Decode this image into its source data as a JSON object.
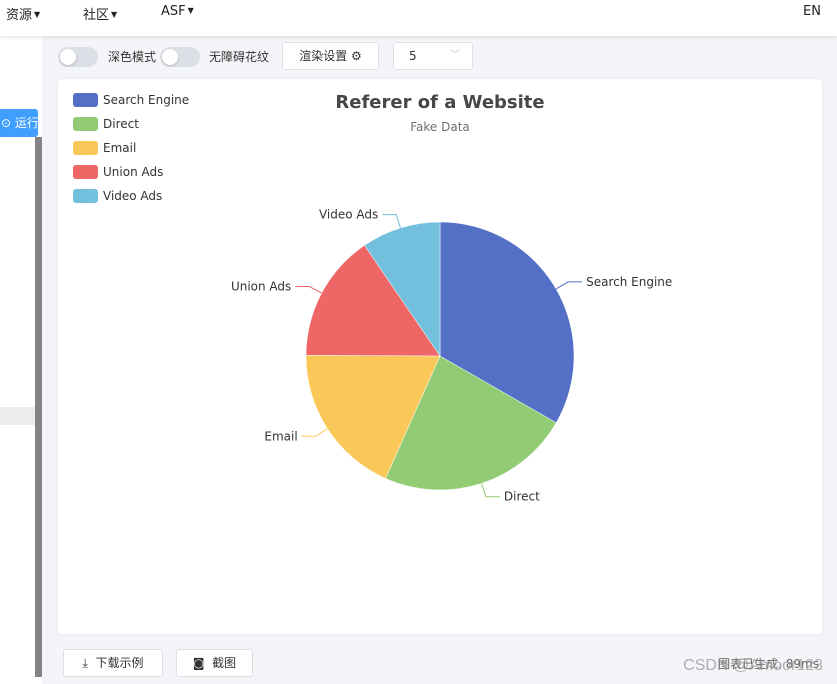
{
  "nav": {
    "items": [
      "资源",
      "社区",
      "ASF"
    ],
    "lang": "EN"
  },
  "sidebar": {
    "run_label": "运行"
  },
  "toolbar": {
    "dark_mode_label": "深色模式",
    "accessible_label": "无障碍花纹",
    "render_settings_label": "渲染设置",
    "select_value": "5"
  },
  "footer": {
    "download_label": "下载示例",
    "screenshot_label": "截图",
    "gen_time": "图表已生成, 89ms",
    "watermark": "CSDN @Amoor123"
  },
  "icons": {
    "download": "download-icon",
    "camera": "camera-icon",
    "gear": "gear-icon",
    "chevron": "chevron-down-icon"
  },
  "chart_data": {
    "type": "pie",
    "title": "Referer of a Website",
    "subtitle": "Fake Data",
    "legend_position": "top-left",
    "categories": [
      "Search Engine",
      "Direct",
      "Email",
      "Union Ads",
      "Video Ads"
    ],
    "values": [
      1048,
      735,
      580,
      484,
      300
    ],
    "colors": [
      "#5470c6",
      "#91cc75",
      "#fac858",
      "#ee6666",
      "#73c0de"
    ]
  }
}
